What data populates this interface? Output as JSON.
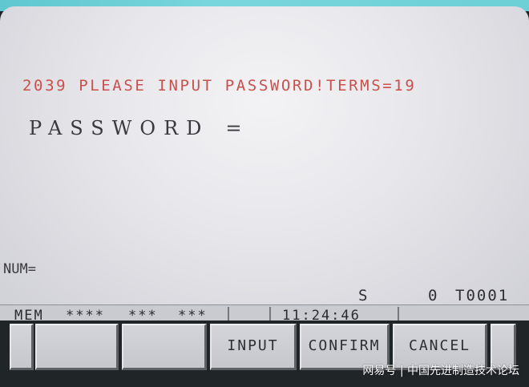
{
  "screen": {
    "alarm_message": "2039 PLEASE INPUT PASSWORD!TERMS=19",
    "password_label": "PASSWORD",
    "password_equals": "=",
    "password_value": "",
    "num_label": "NUM="
  },
  "position_line": {
    "spindle": "S",
    "spindle_value": "0",
    "tool": "T0001"
  },
  "status_bar": {
    "mode": "MEM",
    "field1": "****",
    "field2": "***",
    "field3": "***",
    "time": "11:24:46"
  },
  "softkeys": [
    {
      "label": ""
    },
    {
      "label": ""
    },
    {
      "label": ""
    },
    {
      "label": "INPUT"
    },
    {
      "label": "CONFIRM"
    },
    {
      "label": "CANCEL"
    },
    {
      "label": ""
    }
  ],
  "watermark": "网易号 | 中国先进制造技术论坛",
  "colors": {
    "alarm_text": "#c9504c",
    "screen_bg": "#e8e8ec",
    "bezel": "#1d2224",
    "accent_top": "#6cd0d6"
  }
}
